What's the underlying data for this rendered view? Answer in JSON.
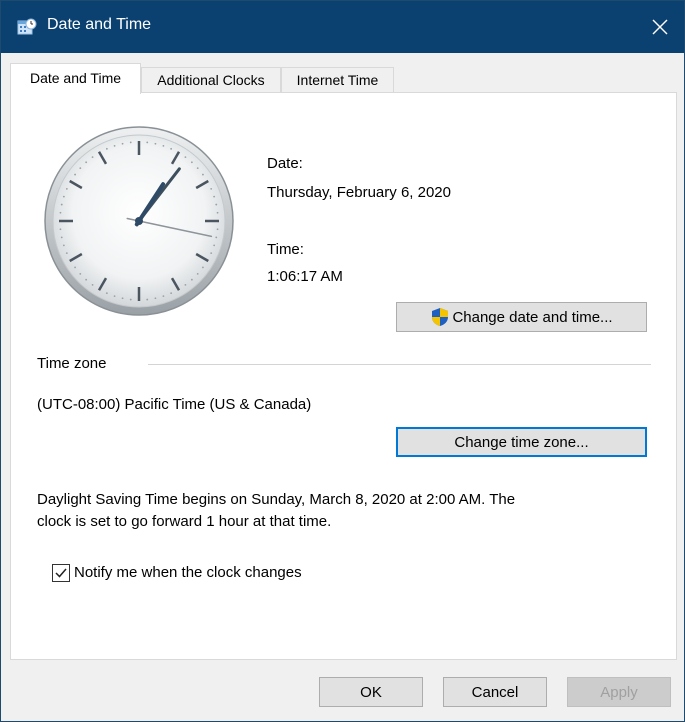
{
  "window": {
    "title": "Date and Time",
    "close_label": "close"
  },
  "tabs": [
    {
      "label": "Date and Time",
      "active": true
    },
    {
      "label": "Additional Clocks",
      "active": false
    },
    {
      "label": "Internet Time",
      "active": false
    }
  ],
  "datetime": {
    "date_label": "Date:",
    "date_value": "Thursday, February 6, 2020",
    "time_label": "Time:",
    "time_value": "1:06:17 AM",
    "change_button": "Change date and time..."
  },
  "timezone": {
    "group_label": "Time zone",
    "value": "(UTC-08:00) Pacific Time (US & Canada)",
    "change_button": "Change time zone..."
  },
  "dst": {
    "line1": "Daylight Saving Time begins on Sunday, March 8, 2020 at 2:00 AM. The",
    "line2": "clock is set to go forward 1 hour at that time."
  },
  "notify": {
    "label": "Notify me when the clock changes",
    "checked": true
  },
  "footer": {
    "ok": "OK",
    "cancel": "Cancel",
    "apply": "Apply"
  },
  "colors": {
    "titlebar": "#0b4170",
    "focus_accent": "#0078d7",
    "shield_blue": "#1f5fbf",
    "shield_yellow": "#f5c400"
  },
  "icons": {
    "title": "date-time-icon",
    "close": "close-icon",
    "shield": "uac-shield-icon",
    "check": "checkmark-icon"
  },
  "clock": {
    "hour": 1,
    "minute": 6,
    "second": 17
  }
}
